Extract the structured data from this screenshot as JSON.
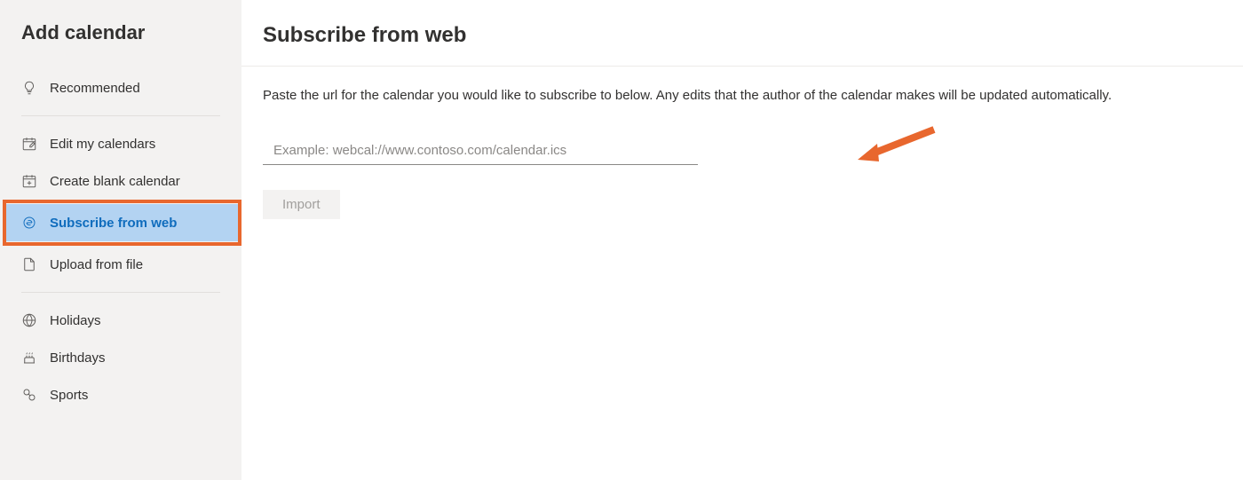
{
  "sidebar": {
    "title": "Add calendar",
    "groups": [
      {
        "items": [
          {
            "key": "recommended",
            "label": "Recommended"
          }
        ]
      },
      {
        "items": [
          {
            "key": "edit-my-calendars",
            "label": "Edit my calendars"
          },
          {
            "key": "create-blank-calendar",
            "label": "Create blank calendar"
          },
          {
            "key": "subscribe-from-web",
            "label": "Subscribe from web"
          },
          {
            "key": "upload-from-file",
            "label": "Upload from file"
          }
        ]
      },
      {
        "items": [
          {
            "key": "holidays",
            "label": "Holidays"
          },
          {
            "key": "birthdays",
            "label": "Birthdays"
          },
          {
            "key": "sports",
            "label": "Sports"
          }
        ]
      }
    ]
  },
  "main": {
    "title": "Subscribe from web",
    "description": "Paste the url for the calendar you would like to subscribe to below. Any edits that the author of the calendar makes will be updated automatically.",
    "url_placeholder": "Example: webcal://www.contoso.com/calendar.ics",
    "url_value": "",
    "import_label": "Import"
  },
  "annotation": {
    "highlight_color": "#e8672e"
  }
}
